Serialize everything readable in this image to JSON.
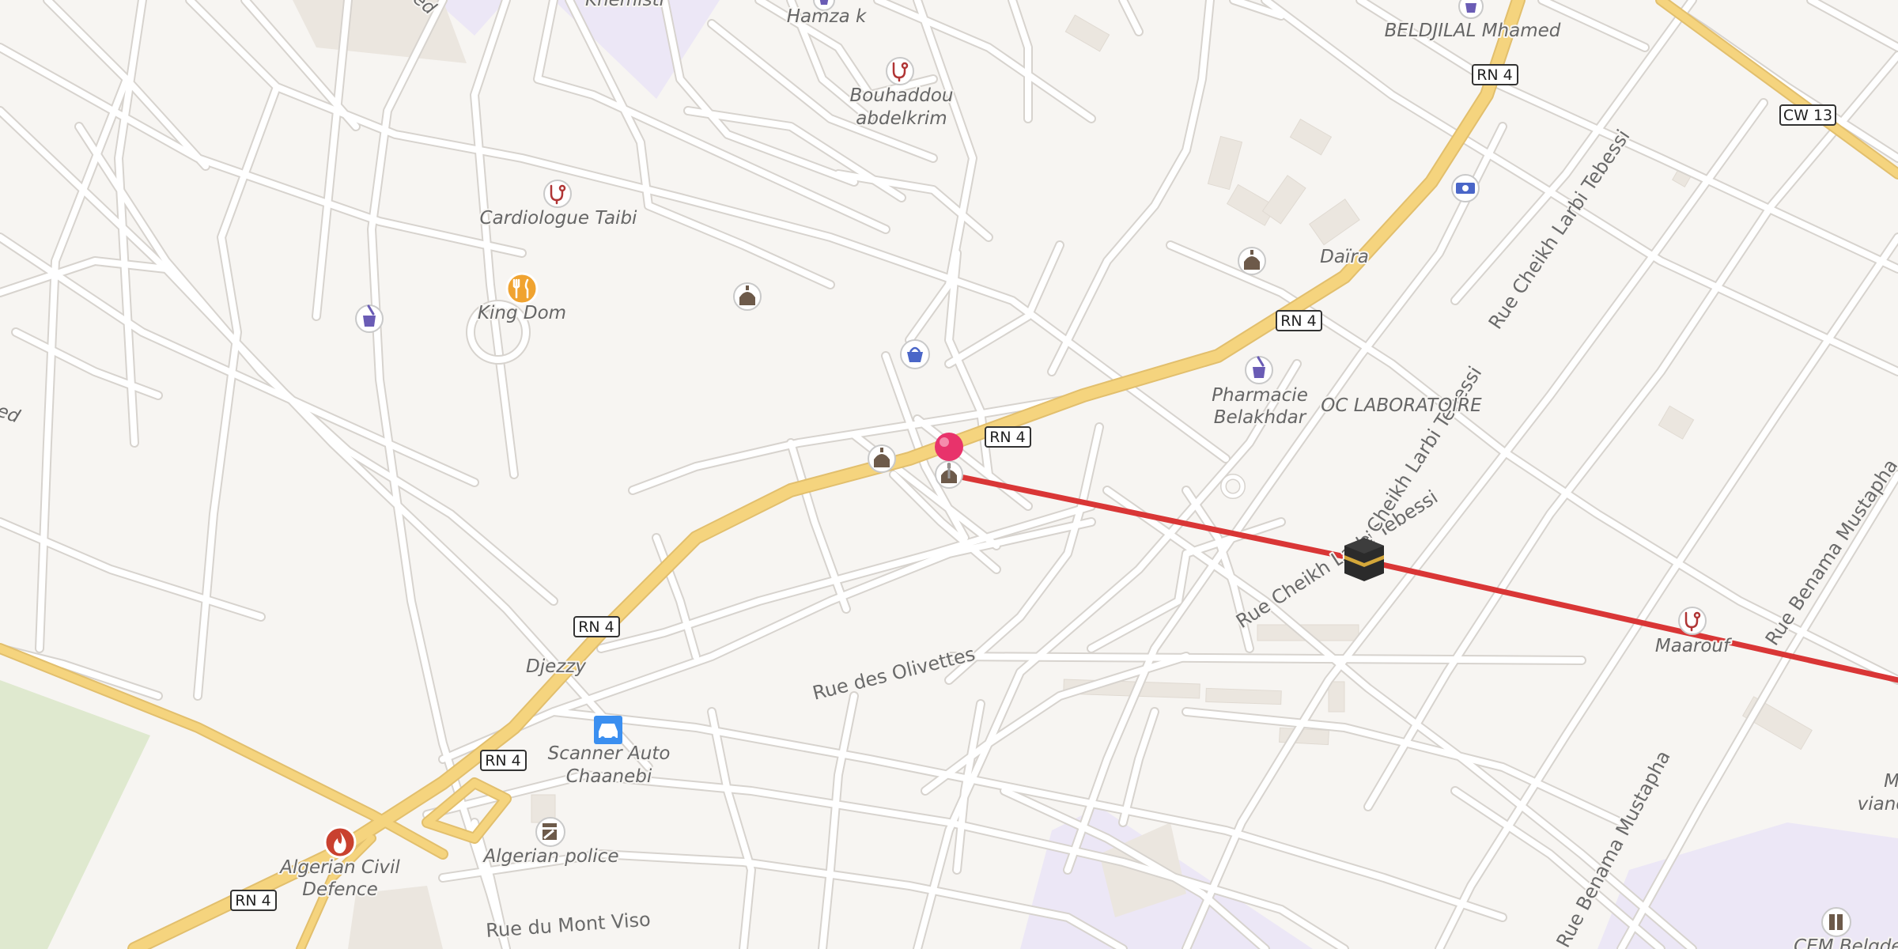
{
  "map": {
    "route_color": "#d93636",
    "pin_color": "#e8336b",
    "highway_color": "#f5d47e",
    "road_shields": [
      {
        "id": "rn4-a",
        "text": "RN 4"
      },
      {
        "id": "rn4-b",
        "text": "RN 4"
      },
      {
        "id": "rn4-c",
        "text": "RN 4"
      },
      {
        "id": "rn4-d",
        "text": "RN 4"
      },
      {
        "id": "rn4-e",
        "text": "RN 4"
      },
      {
        "id": "rn4-f",
        "text": "RN 4"
      },
      {
        "id": "cw13",
        "text": "CW 13"
      }
    ],
    "streets": {
      "olivettes": "Rue des Olivettes",
      "mont_viso": "Rue du Mont Viso",
      "larbi_tebessi_1": "Rue Cheikh Larbi Tebessi",
      "larbi_tebessi_2": "Rue Cheikh Larbi Tebessi",
      "larbi_tebessi_3": "Rue Cheikh Larbi Tebessi",
      "benama_1": "Rue Benama Mustapha",
      "benama_2": "Rue Benama Mustapha"
    },
    "places": {
      "khemisti": "Khemisti",
      "hamza": "Hamza k",
      "beldjilal": "BELDJILAL Mhamed",
      "bouhaddou_1": "Bouhaddou",
      "bouhaddou_2": "abdelkrim",
      "cardiologue": "Cardiologue Taibi",
      "king_dom": "King Dom",
      "daira": "Daïra",
      "pharmacie_1": "Pharmacie",
      "pharmacie_2": "Belakhdar",
      "oc_lab": "OC LABORATOIRE",
      "maarouf": "Maarouf",
      "djezzy": "Djezzy",
      "scanner_1": "Scanner Auto",
      "scanner_2": "Chaanebi",
      "civil_1": "Algerian Civil",
      "civil_2": "Defence",
      "police": "Algerian police",
      "cem": "CEM Belqdem",
      "m_vian_1": "M",
      "m_vian_2": "viano",
      "edge_ed_top": "ed",
      "edge_ed_left": "ed"
    },
    "icons": [
      "stethoscope-icon",
      "restaurant-icon",
      "pharmacy-icon",
      "mosque-icon",
      "shopping-bag-icon",
      "bank-note-icon",
      "fire-station-icon",
      "car-icon",
      "police-icon",
      "school-icon",
      "kaaba-icon",
      "map-pin-icon"
    ]
  }
}
